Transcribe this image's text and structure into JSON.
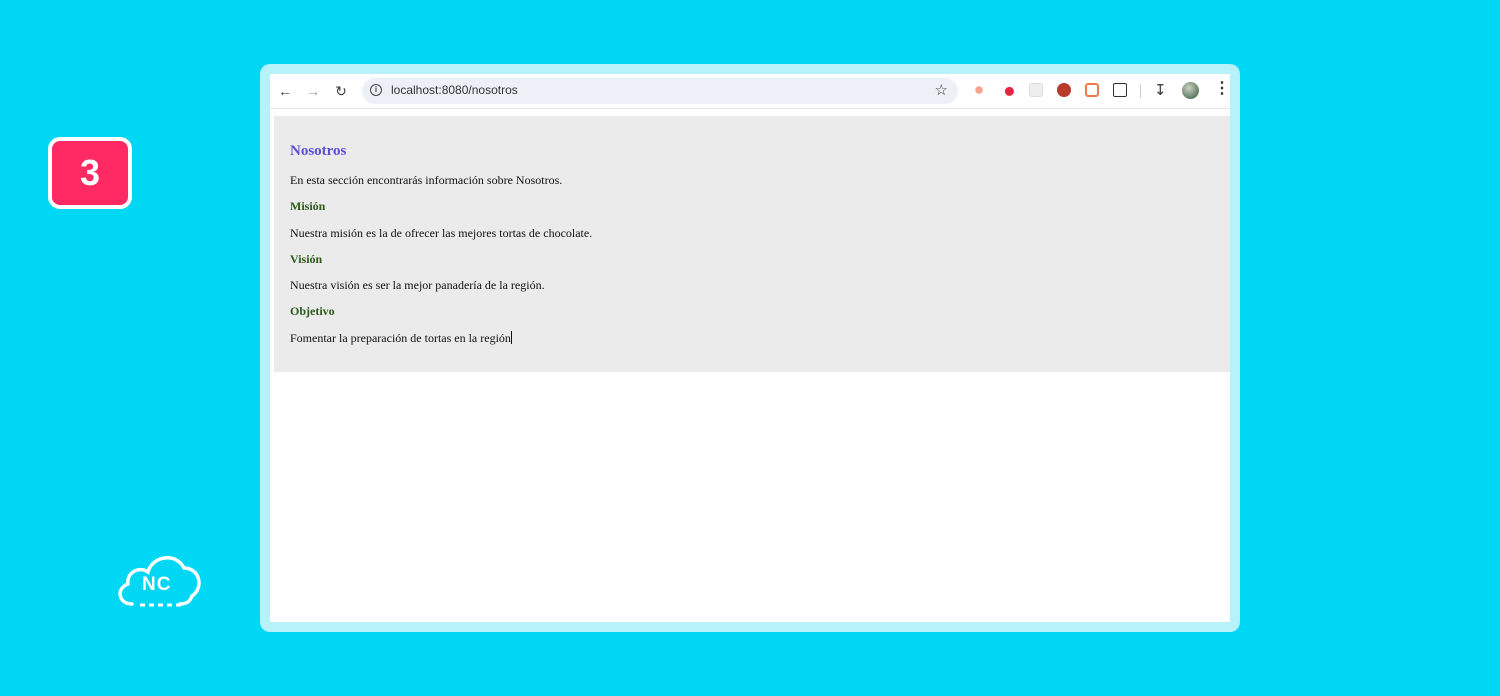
{
  "badge": {
    "number": "3"
  },
  "logo": {
    "text": "NC"
  },
  "browser": {
    "url": "localhost:8080/nosotros",
    "icons": [
      "back-arrow-icon",
      "forward-arrow-icon",
      "reload-icon",
      "site-info-icon",
      "star-icon",
      "download-icon",
      "avatar",
      "more-menu-icon"
    ]
  },
  "content": {
    "title": "Nosotros",
    "intro": "En esta sección encontrarás información sobre Nosotros.",
    "mission_heading": "Misión",
    "mission_text": "Nuestra misión es la de ofrecer las mejores tortas de chocolate.",
    "vision_heading": "Visión",
    "vision_text": "Nuestra visión es ser la mejor panadería de la región.",
    "objective_heading": "Objetivo",
    "objective_text": "Fomentar la preparación de tortas en la región"
  },
  "colors": {
    "background": "#00d7f5",
    "badge": "#ff2a63",
    "title": "#5b4fd6",
    "subheading": "#2b5a1a",
    "content_bg": "#ebebeb"
  }
}
